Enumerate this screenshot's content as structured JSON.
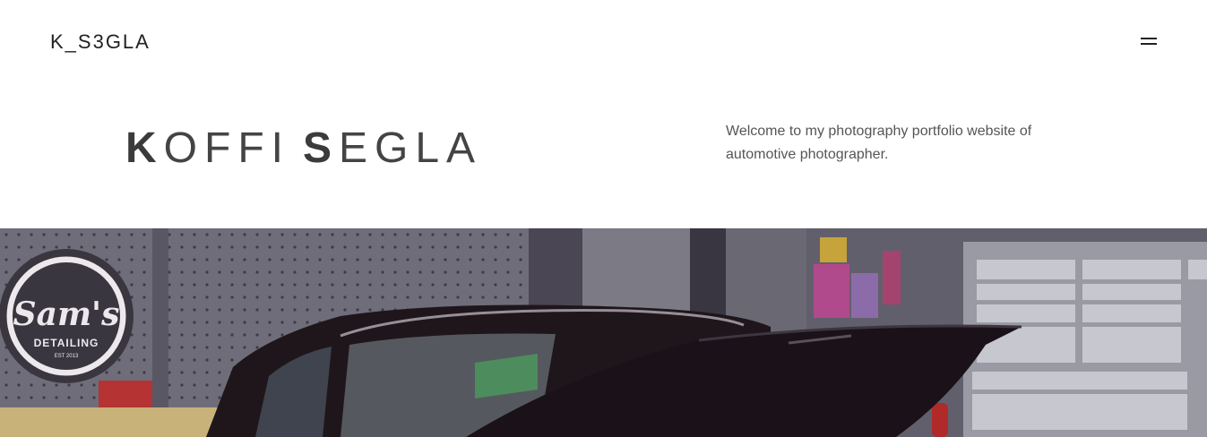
{
  "header": {
    "logo": "K_S3GLA",
    "menu_icon": "hamburger-menu-icon"
  },
  "hero": {
    "first_initial": "K",
    "first_rest": "OFFI",
    "last_initial": "S",
    "last_rest": "EGLA",
    "intro_text": "Welcome to my photography portfolio website of automotive photographer."
  },
  "photo": {
    "sign_line1": "Sam's",
    "sign_line2": "DETAILING",
    "sign_line3": "EST 2013"
  }
}
